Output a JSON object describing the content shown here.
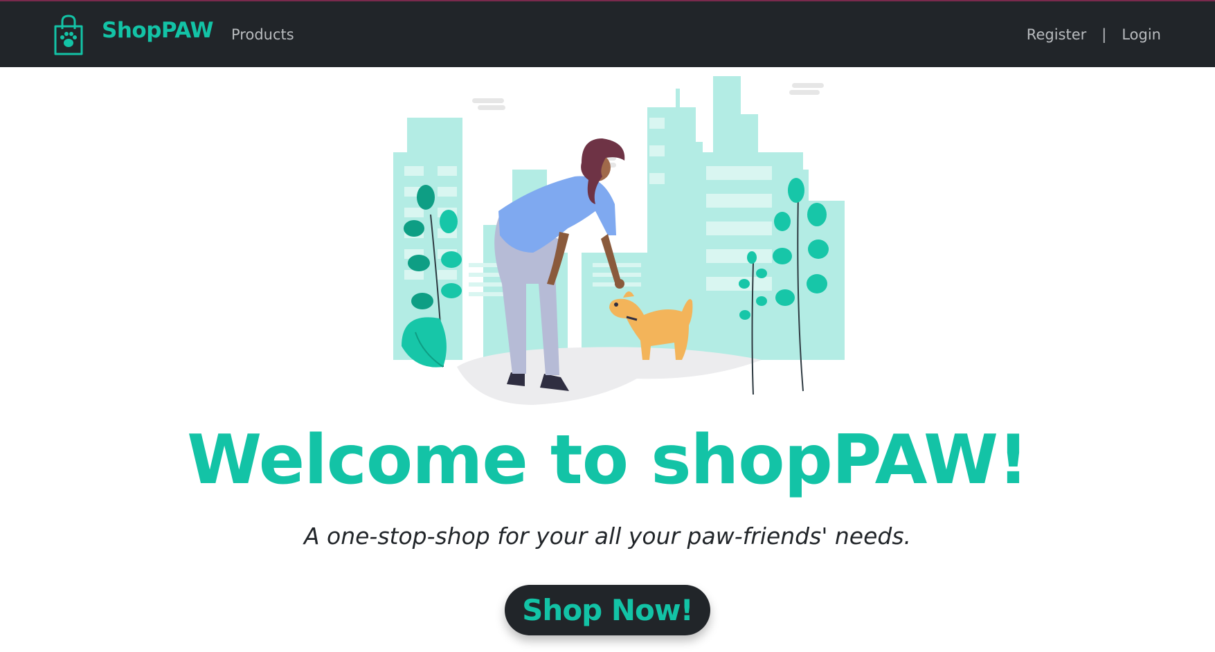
{
  "colors": {
    "brand": "#13c3a6",
    "navbar_bg": "#212529",
    "nav_link": "#b9bcbf",
    "tagline_text": "#212529",
    "city": "#b3ece4",
    "leaf_dark": "#0e9e84",
    "leaf_light": "#17c6a8",
    "shirt": "#7fa9f0",
    "pants": "#b6bbd6",
    "hair": "#6e3345",
    "dog": "#f3b45a"
  },
  "navbar": {
    "brand_icon": "shopping-bag-paw-icon",
    "brand_name": "ShopPAW",
    "products_link": "Products",
    "register_link": "Register",
    "separator": "|",
    "login_link": "Login"
  },
  "hero": {
    "illustration": "woman-petting-dog-city-illustration",
    "title": "Welcome to shopPAW!",
    "tagline": "A one-stop-shop for your all your paw-friends' needs.",
    "cta_label": "Shop Now!"
  }
}
